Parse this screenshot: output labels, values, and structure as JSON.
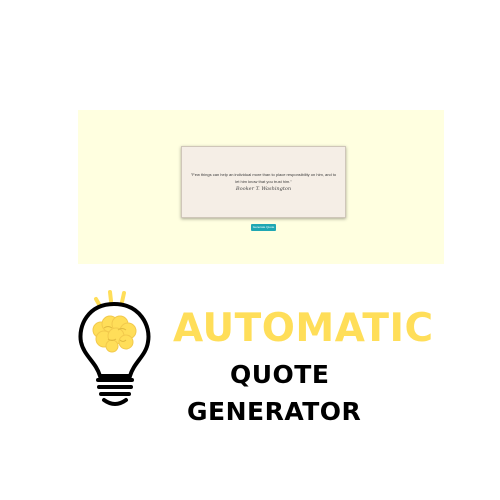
{
  "app": {
    "background_color": "#ffffe0",
    "quote_card": {
      "text": "\"Few things can help an individual more than to place responsibility on him, and to let him know that you trust him.\"",
      "author": "Booker T. Washington",
      "background_color": "#f5eee6"
    },
    "generate_button": {
      "label": "Generate Quote",
      "color": "#1fa7b3"
    }
  },
  "branding": {
    "line1": "AUTOMATIC",
    "line2": "QUOTE",
    "line3": "GENERATOR",
    "accent_color": "#ffde59",
    "text_color": "#000000",
    "icon": "lightbulb-brain-icon"
  }
}
